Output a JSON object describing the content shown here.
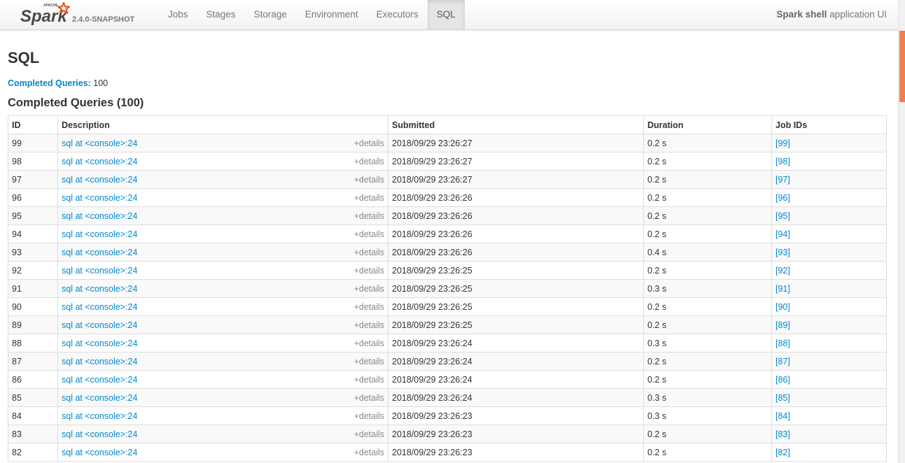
{
  "brand": {
    "logo_top_text": "APACHE",
    "logo_text": "Spark",
    "version": "2.4.0-SNAPSHOT",
    "accent_color": "#e25a1c"
  },
  "nav": {
    "tabs": [
      "Jobs",
      "Stages",
      "Storage",
      "Environment",
      "Executors",
      "SQL"
    ],
    "active_tab": "SQL"
  },
  "app": {
    "name_bold": "Spark shell",
    "name_suffix": " application UI"
  },
  "page": {
    "title": "SQL",
    "summary_label": "Completed Queries:",
    "summary_value": "100",
    "section_title": "Completed Queries (100)"
  },
  "table": {
    "columns": [
      "ID",
      "Description",
      "Submitted",
      "Duration",
      "Job IDs"
    ],
    "details_label": "+details",
    "rows": [
      {
        "id": "99",
        "description": "sql at <console>:24",
        "submitted": "2018/09/29 23:26:27",
        "duration": "0.2 s",
        "job_ids": "[99]"
      },
      {
        "id": "98",
        "description": "sql at <console>:24",
        "submitted": "2018/09/29 23:26:27",
        "duration": "0.2 s",
        "job_ids": "[98]"
      },
      {
        "id": "97",
        "description": "sql at <console>:24",
        "submitted": "2018/09/29 23:26:27",
        "duration": "0.2 s",
        "job_ids": "[97]"
      },
      {
        "id": "96",
        "description": "sql at <console>:24",
        "submitted": "2018/09/29 23:26:26",
        "duration": "0.2 s",
        "job_ids": "[96]"
      },
      {
        "id": "95",
        "description": "sql at <console>:24",
        "submitted": "2018/09/29 23:26:26",
        "duration": "0.2 s",
        "job_ids": "[95]"
      },
      {
        "id": "94",
        "description": "sql at <console>:24",
        "submitted": "2018/09/29 23:26:26",
        "duration": "0.2 s",
        "job_ids": "[94]"
      },
      {
        "id": "93",
        "description": "sql at <console>:24",
        "submitted": "2018/09/29 23:26:26",
        "duration": "0.4 s",
        "job_ids": "[93]"
      },
      {
        "id": "92",
        "description": "sql at <console>:24",
        "submitted": "2018/09/29 23:26:25",
        "duration": "0.2 s",
        "job_ids": "[92]"
      },
      {
        "id": "91",
        "description": "sql at <console>:24",
        "submitted": "2018/09/29 23:26:25",
        "duration": "0.3 s",
        "job_ids": "[91]"
      },
      {
        "id": "90",
        "description": "sql at <console>:24",
        "submitted": "2018/09/29 23:26:25",
        "duration": "0.2 s",
        "job_ids": "[90]"
      },
      {
        "id": "89",
        "description": "sql at <console>:24",
        "submitted": "2018/09/29 23:26:25",
        "duration": "0.2 s",
        "job_ids": "[89]"
      },
      {
        "id": "88",
        "description": "sql at <console>:24",
        "submitted": "2018/09/29 23:26:24",
        "duration": "0.3 s",
        "job_ids": "[88]"
      },
      {
        "id": "87",
        "description": "sql at <console>:24",
        "submitted": "2018/09/29 23:26:24",
        "duration": "0.2 s",
        "job_ids": "[87]"
      },
      {
        "id": "86",
        "description": "sql at <console>:24",
        "submitted": "2018/09/29 23:26:24",
        "duration": "0.2 s",
        "job_ids": "[86]"
      },
      {
        "id": "85",
        "description": "sql at <console>:24",
        "submitted": "2018/09/29 23:26:24",
        "duration": "0.3 s",
        "job_ids": "[85]"
      },
      {
        "id": "84",
        "description": "sql at <console>:24",
        "submitted": "2018/09/29 23:26:23",
        "duration": "0.3 s",
        "job_ids": "[84]"
      },
      {
        "id": "83",
        "description": "sql at <console>:24",
        "submitted": "2018/09/29 23:26:23",
        "duration": "0.2 s",
        "job_ids": "[83]"
      },
      {
        "id": "82",
        "description": "sql at <console>:24",
        "submitted": "2018/09/29 23:26:23",
        "duration": "0.2 s",
        "job_ids": "[82]"
      }
    ]
  }
}
